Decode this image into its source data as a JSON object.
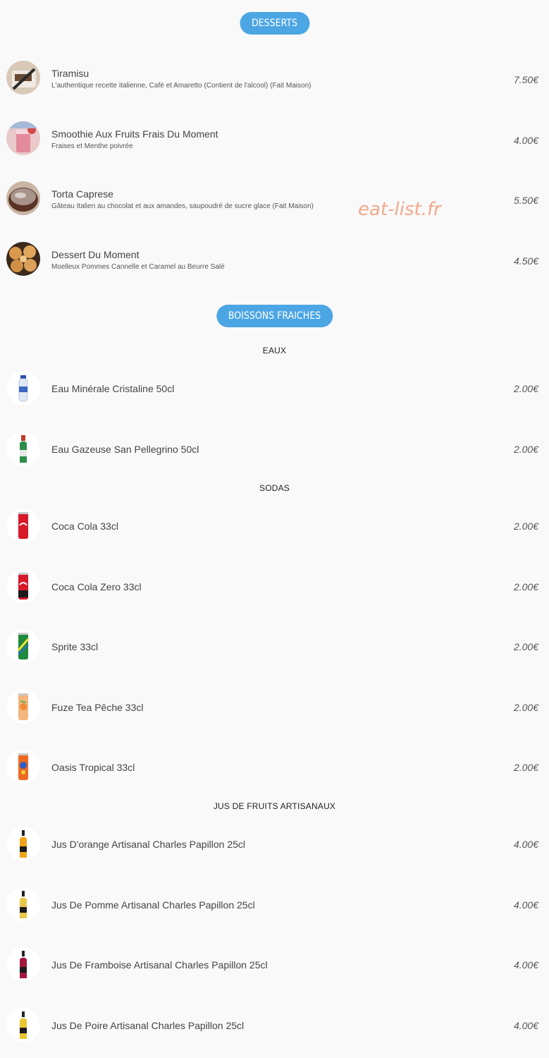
{
  "watermark": "eat-list.fr",
  "sections": {
    "desserts": {
      "title": "DESSERTS",
      "items": [
        {
          "name": "Tiramisu",
          "description": "L'authentique recette italienne, Café et Amaretto (Contient de l'alcool) (Fait Maison)",
          "price": "7.50€",
          "icon": "tiramisu-photo"
        },
        {
          "name": "Smoothie Aux Fruits Frais Du Moment",
          "description": "Fraises et Menthe poivrée",
          "price": "4.00€",
          "icon": "smoothie-photo"
        },
        {
          "name": "Torta Caprese",
          "description": "Gâteau Italien au chocolat et aux amandes, saupoudré de sucre glace (Fait Maison)",
          "price": "5.50€",
          "icon": "cake-photo"
        },
        {
          "name": "Dessert Du Moment",
          "description": "Moelleux Pommes Cannelle et Caramel au Beurre Salé",
          "price": "4.50€",
          "icon": "pastry-photo"
        }
      ]
    },
    "boissons": {
      "title": "BOISSONS FRAICHES",
      "groups": [
        {
          "title": "EAUX",
          "items": [
            {
              "name": "Eau Minérale Cristaline 50cl",
              "price": "2.00€",
              "icon": "water-bottle-icon"
            },
            {
              "name": "Eau Gazeuse San Pellegrino 50cl",
              "price": "2.00€",
              "icon": "green-bottle-icon"
            }
          ]
        },
        {
          "title": "SODAS",
          "items": [
            {
              "name": "Coca Cola 33cl",
              "price": "2.00€",
              "icon": "coca-can-icon"
            },
            {
              "name": "Coca Cola Zero 33cl",
              "price": "2.00€",
              "icon": "coca-zero-can-icon"
            },
            {
              "name": "Sprite 33cl",
              "price": "2.00€",
              "icon": "sprite-can-icon"
            },
            {
              "name": "Fuze Tea Pêche 33cl",
              "price": "2.00€",
              "icon": "fuze-tea-can-icon"
            },
            {
              "name": "Oasis Tropical 33cl",
              "price": "2.00€",
              "icon": "oasis-can-icon"
            }
          ]
        },
        {
          "title": "JUS DE FRUITS ARTISANAUX",
          "items": [
            {
              "name": "Jus D'orange Artisanal Charles Papillon 25cl",
              "price": "4.00€",
              "icon": "orange-juice-bottle-icon"
            },
            {
              "name": "Jus De Pomme Artisanal Charles Papillon 25cl",
              "price": "4.00€",
              "icon": "apple-juice-bottle-icon"
            },
            {
              "name": "Jus De Framboise Artisanal Charles Papillon 25cl",
              "price": "4.00€",
              "icon": "raspberry-juice-bottle-icon"
            },
            {
              "name": "Jus De Poire Artisanal Charles Papillon 25cl",
              "price": "4.00€",
              "icon": "pear-juice-bottle-icon"
            }
          ]
        }
      ]
    }
  },
  "colors": {
    "pill": "#4ca6e4",
    "background": "#f9f9f9",
    "watermark": "#f2a98a"
  }
}
